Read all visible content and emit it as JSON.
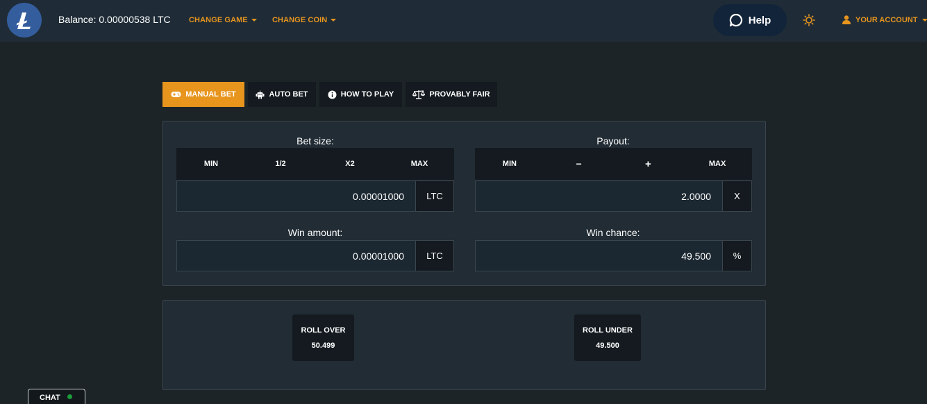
{
  "header": {
    "balance": "Balance: 0.00000538 LTC",
    "change_game": "CHANGE GAME",
    "change_coin": "CHANGE COIN",
    "help": "Help",
    "account": "YOUR ACCOUNT"
  },
  "tabs": [
    {
      "label": "MANUAL BET",
      "icon": "gamepad-icon",
      "active": true
    },
    {
      "label": "AUTO BET",
      "icon": "robot-icon",
      "active": false
    },
    {
      "label": "HOW TO PLAY",
      "icon": "info-icon",
      "active": false
    },
    {
      "label": "PROVABLY FAIR",
      "icon": "scale-icon",
      "active": false
    }
  ],
  "bet_size": {
    "label": "Bet size:",
    "buttons": [
      "MIN",
      "1/2",
      "X2",
      "MAX"
    ],
    "value": "0.00001000",
    "unit": "LTC"
  },
  "payout": {
    "label": "Payout:",
    "buttons": [
      "MIN",
      "−",
      "+",
      "MAX"
    ],
    "value": "2.0000",
    "unit": "X"
  },
  "win_amount": {
    "label": "Win amount:",
    "value": "0.00001000",
    "unit": "LTC"
  },
  "win_chance": {
    "label": "Win chance:",
    "value": "49.500",
    "unit": "%"
  },
  "roll_over": {
    "label": "ROLL OVER",
    "value": "50.499"
  },
  "roll_under": {
    "label": "ROLL UNDER",
    "value": "49.500"
  },
  "chat": {
    "label": "CHAT",
    "status_color": "#1c9b3a"
  },
  "colors": {
    "accent": "#e8951e",
    "header_bg": "#1f2c37",
    "page_bg": "#1d2428",
    "logo": "#345d9d"
  }
}
